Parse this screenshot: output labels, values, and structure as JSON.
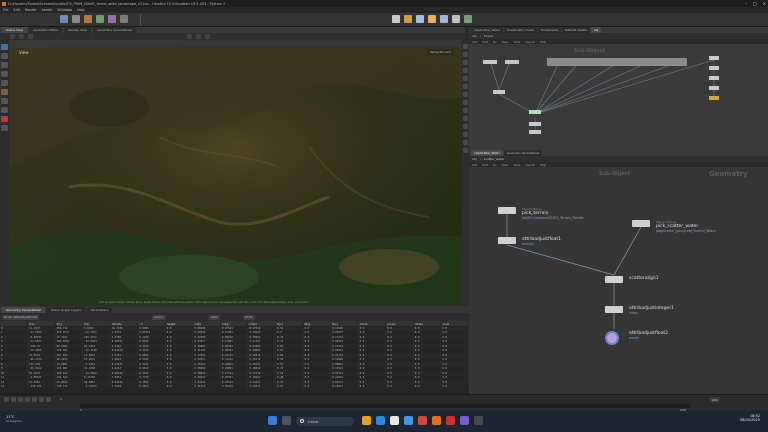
{
  "window": {
    "title": "D:/Houdini/Forest/Scenes/houdini/FX_PRIM_GIANT_forest_wide_landscape_v2.hip - Houdini FX Education 19.5.403 - Python 3"
  },
  "menu": [
    "File",
    "Edit",
    "Render",
    "Assets",
    "Windows",
    "Help"
  ],
  "left_tabs": [
    "Scene View",
    "Animation Editor",
    "Render View",
    "Geometry Spreadsheet"
  ],
  "viewport": {
    "label": "View",
    "camera_info": "Persp  No cam",
    "statusline": "Left mouse tumbles. Middle pans. Right dollies. Ctrl+Alt+Left box-zooms. Ctrl+Right zooms. Spacebar-Ctrl-Left tilts. Hold L for alternate tumble, dolly, and zoom."
  },
  "mid_tabs": [
    "Geometry Spreadsheet",
    "Scene Graph Layers",
    "Parameters"
  ],
  "spreadsheet_bar": [
    "Node: attribadjustfloat2",
    "Group:",
    "View",
    "Attrib:"
  ],
  "spreadsheet": {
    "columns": [
      "",
      "P[x]",
      "P[y]",
      "P[z]",
      "density",
      "cd",
      "height",
      "Cd[r]",
      "Cd[g]",
      "Cd[b]",
      "N[x]",
      "N[y]",
      "N[z]",
      "orient",
      "pscale",
      "rotate",
      "scale"
    ],
    "rows": [
      [
        "0",
        "11.2557",
        "256.711",
        "5.6049",
        "10.7239",
        "0.9905",
        "0.0",
        "0.29026",
        "0.27521",
        "0.17519",
        "0.51",
        "0.0",
        "0.14595",
        "0.0",
        "0.0",
        "0.0",
        "0.0"
      ],
      [
        "1",
        "-11.9926",
        "220.2531",
        "-12.3561",
        "1.8374",
        "0.03412",
        "0.0",
        "0.29042",
        "0.27581",
        "0.43023",
        "0.3",
        "0.0",
        "0.09523",
        "0.0",
        "0.0",
        "0.0",
        "0.0"
      ],
      [
        "2",
        "-6.60231",
        "12.1151",
        "102.4311",
        "1.2765",
        "0.7432",
        "0.0",
        "0.37823",
        "0.39212",
        "0.35821",
        "0.43",
        "0.0",
        "0.17321",
        "0.0",
        "0.0",
        "0.0",
        "0.0"
      ],
      [
        "3",
        "-14.8531",
        "184.5201",
        "-61.5924",
        "0.18327",
        "0.0912",
        "0.0",
        "0.33817",
        "0.17001",
        "0.21337",
        "0.12",
        "0.0",
        "0.00319",
        "0.0",
        "0.0",
        "0.0",
        "0.0"
      ],
      [
        "4",
        "-196.75",
        "62.5381",
        "87.7212",
        "1.7312",
        "0.4435",
        "0.0",
        "0.29961",
        "0.28193",
        "0.23382",
        "0.81",
        "0.0",
        "0.13742",
        "0.0",
        "0.0",
        "0.0",
        "0.0"
      ],
      [
        "5",
        "-10.2461",
        "176.341",
        "-42.1139",
        "0.61213",
        "0.3124",
        "0.0",
        "0.31102",
        "0.30021",
        "0.19822",
        "0.27",
        "0.0",
        "0.06411",
        "0.0",
        "0.0",
        "0.0",
        "0.0"
      ],
      [
        "6",
        "23.4512",
        "201.552",
        "13.0922",
        "2.1151",
        "0.8811",
        "0.0",
        "0.27654",
        "0.26112",
        "0.16211",
        "0.64",
        "0.0",
        "0.21133",
        "0.0",
        "0.0",
        "0.0",
        "0.0"
      ],
      [
        "7",
        "-88.1723",
        "99.2013",
        "55.6521",
        "1.0023",
        "0.5102",
        "0.0",
        "0.32011",
        "0.31122",
        "0.20112",
        "0.39",
        "0.0",
        "0.11002",
        "0.0",
        "0.0",
        "0.0",
        "0.0"
      ],
      [
        "8",
        "120.559",
        "14.2891",
        "-7.3311",
        "0.77231",
        "0.2211",
        "0.0",
        "0.35512",
        "0.34021",
        "0.25511",
        "0.55",
        "0.0",
        "0.08821",
        "0.0",
        "0.0",
        "0.0",
        "0.0"
      ],
      [
        "9",
        "-45.6612",
        "133.901",
        "31.2203",
        "1.4412",
        "0.6623",
        "0.0",
        "0.30092",
        "0.29001",
        "0.18812",
        "0.71",
        "0.0",
        "0.15512",
        "0.0",
        "0.0",
        "0.0",
        "0.0"
      ],
      [
        "10",
        "61.2235",
        "188.122",
        "-24.9812",
        "0.95512",
        "0.4011",
        "0.0",
        "0.28812",
        "0.27721",
        "0.17712",
        "0.22",
        "0.0",
        "0.07712",
        "0.0",
        "0.0",
        "0.0",
        "0.0"
      ],
      [
        "11",
        "-3.88121",
        "241.332",
        "8.11203",
        "1.9912",
        "0.7712",
        "0.0",
        "0.29512",
        "0.28331",
        "0.18221",
        "0.48",
        "0.0",
        "0.12021",
        "0.0",
        "0.0",
        "0.0",
        "0.0"
      ],
      [
        "12",
        "77.4481",
        "45.6612",
        "92.0012",
        "0.44121",
        "0.1522",
        "0.0",
        "0.34412",
        "0.33121",
        "0.24411",
        "0.33",
        "0.0",
        "0.05511",
        "0.0",
        "0.0",
        "0.0",
        "0.0"
      ],
      [
        "13",
        "-130.221",
        "158.771",
        "-3.22011",
        "1.2203",
        "0.5812",
        "0.0",
        "0.31512",
        "0.30412",
        "0.21011",
        "0.61",
        "0.0",
        "0.14011",
        "0.0",
        "0.0",
        "0.0",
        "0.0"
      ]
    ]
  },
  "right_top": {
    "tabs": [
      "/obj/Scatter_Water",
      "Tree/Scatter_Forest",
      "TreeVariants",
      "Material Palette",
      "obj"
    ],
    "path": [
      "obj",
      "Forest"
    ],
    "menu": [
      "Add",
      "Edit",
      "Go",
      "View",
      "Tools",
      "Layout",
      "Help"
    ],
    "ctx_label": "Sub-Object"
  },
  "right_bottom": {
    "tabs": [
      "/obj/Scatter_Water",
      "Geometry Spreadsheet"
    ],
    "path": [
      "obj",
      "scatter_water"
    ],
    "menu": [
      "Add",
      "Edit",
      "Go",
      "View",
      "Tools",
      "Layout",
      "Help"
    ],
    "ctx_label": "Geometry",
    "ctx_label2": "Sub-Object",
    "nodes": [
      {
        "name": "pick_terrain",
        "type": "Object Merge",
        "sub": "/obj/Environment/2507_Terrain_Render"
      },
      {
        "name": "attribadjustfloat1",
        "type": "",
        "sub": "density"
      },
      {
        "name": "pick_scatter_water",
        "type": "Object Merge",
        "sub": "/obj/Scatter_pony/Leaf_Scatter_Water"
      },
      {
        "name": "scatteralign1",
        "type": "",
        "sub": ""
      },
      {
        "name": "attribadjustinteger1",
        "type": "",
        "sub": "index"
      },
      {
        "name": "attribadjustfloat2",
        "type": "",
        "sub": "pscale"
      }
    ]
  },
  "timeline": {
    "frame": "1",
    "range_start": "1",
    "range_end": "240",
    "end_field": "240"
  },
  "taskbar": {
    "weather_temp": "11°C",
    "weather_desc": "Soleggiato",
    "search": "Cerca",
    "time": "18:52",
    "date": "08/04/2025"
  }
}
